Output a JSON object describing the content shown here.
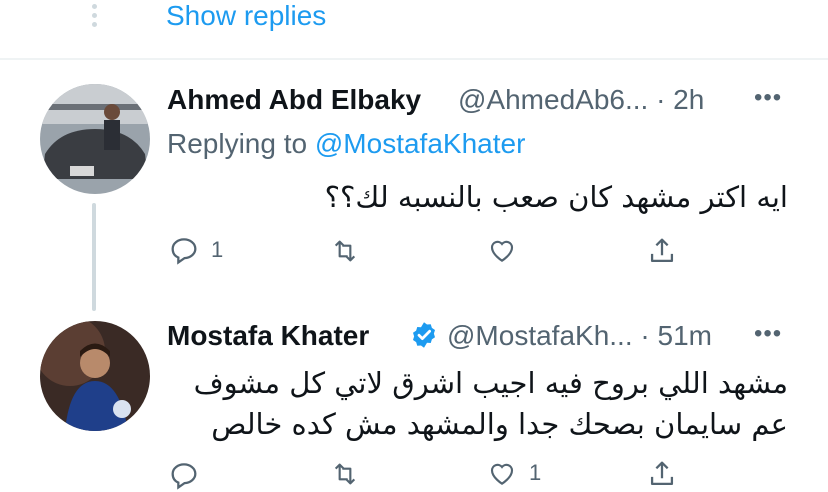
{
  "top": {
    "show_replies": "Show replies"
  },
  "tweets": [
    {
      "name": "Ahmed Abd Elbaky",
      "handle_time": "@AhmedAb6... · 2h",
      "replying_prefix": "Replying to ",
      "replying_handle": "@MostafaKhater",
      "text": "ايه اكتر مشهد كان صعب بالنسبه لك؟؟",
      "reply_count": "1"
    },
    {
      "name": "Mostafa Khater",
      "handle_time": "@MostafaKh... · 51m",
      "text_line1": "مشهد اللي بروح فيه اجيب اشرق لاتي كل مشوف",
      "text_line2": "عم سايمان بصحك جدا والمشهد مش كده خالص",
      "like_count": "1"
    }
  ],
  "colors": {
    "accent": "#1d9bf0",
    "muted": "#536471",
    "text": "#0f1419",
    "verified": "#1d9bf0"
  }
}
